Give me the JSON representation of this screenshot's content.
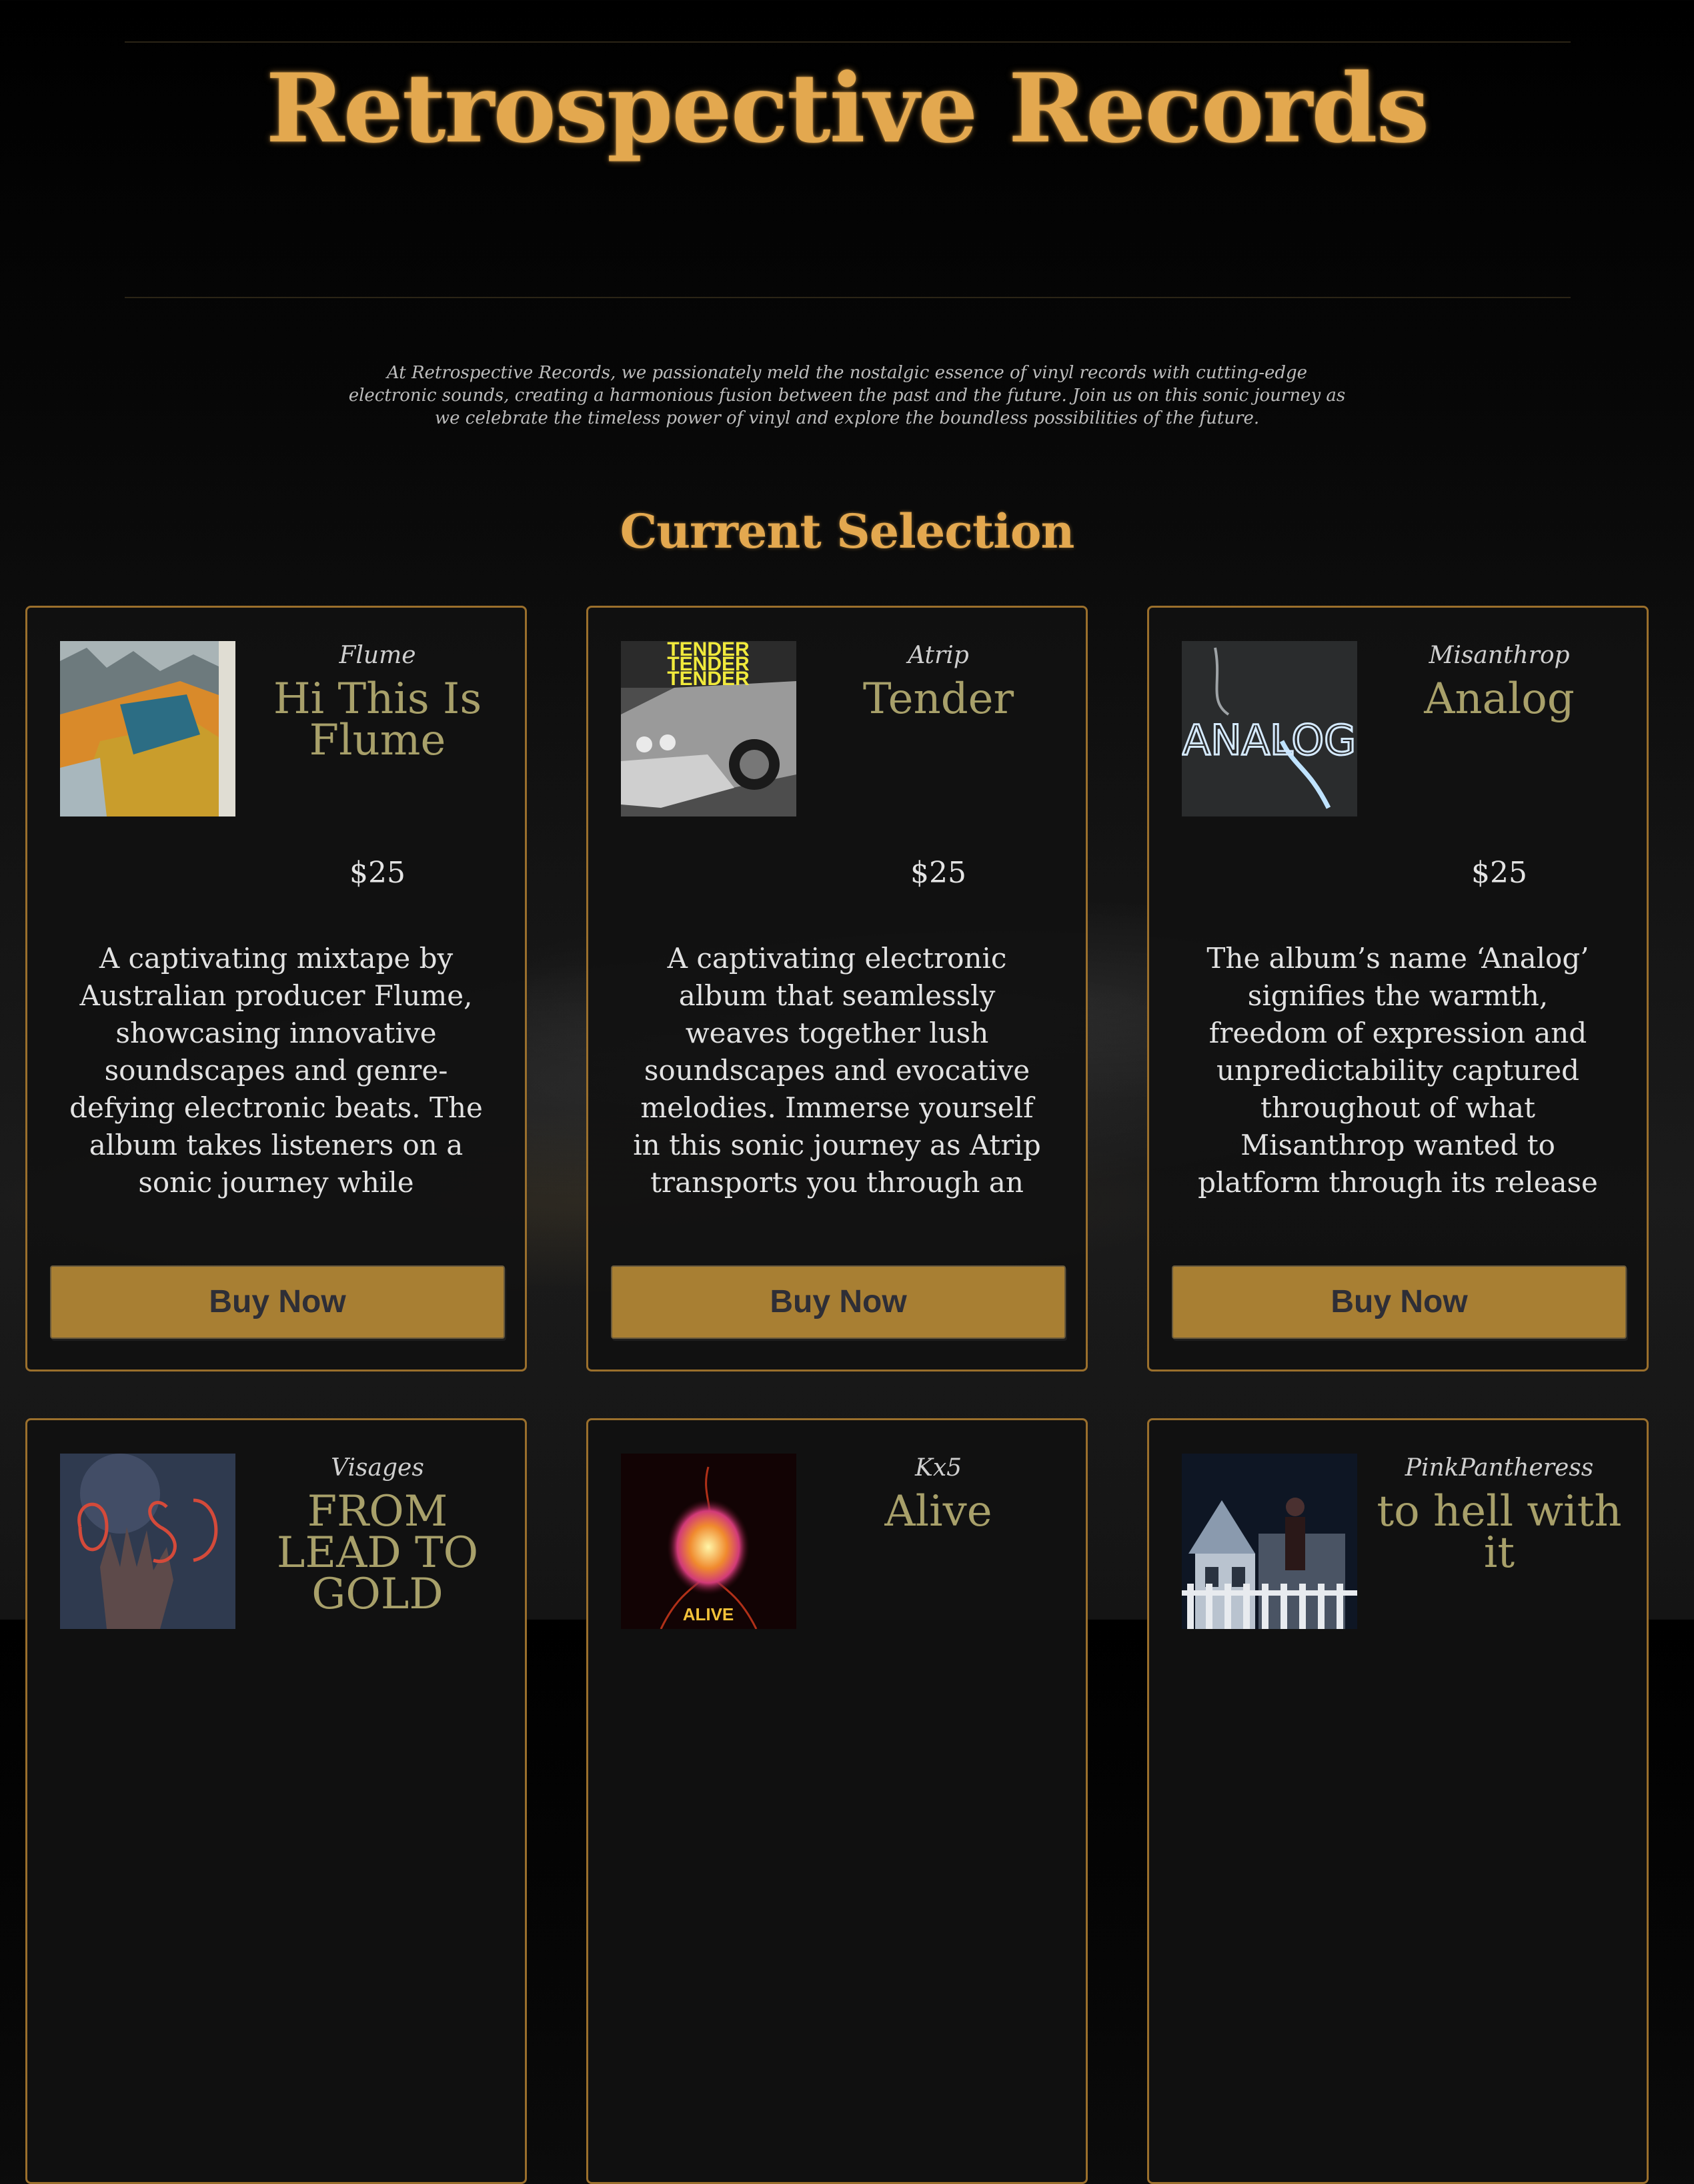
{
  "header": {
    "title": "Retrospective Records",
    "intro": "At Retrospective Records, we passionately meld the nostalgic essence of vinyl records with cutting-edge electronic sounds, creating a harmonious fusion between the past and the future. Join us on this sonic journey as we celebrate the timeless power of vinyl and explore the boundless possibilities of the future."
  },
  "selection": {
    "heading": "Current Selection",
    "records": [
      {
        "artist": "Flume",
        "album": "Hi This Is Flume",
        "price": "$25",
        "description": "A captivating mixtape by Australian producer Flume, showcasing innovative soundscapes and genre-defying electronic beats. The album takes listeners on a sonic journey while solidifying Flume's status as a",
        "buy_label": "Buy Now",
        "cover_icon": "car-hood-cover-art-icon"
      },
      {
        "artist": "Atrip",
        "album": "Tender",
        "price": "$25",
        "description": "A captivating electronic album that seamlessly weaves together lush soundscapes and evocative melodies. Immerse yourself in this sonic journey as Atrip transports you through an emotionally charged and exhilarating auditory",
        "buy_label": "Buy Now",
        "cover_icon": "silver-car-cover-art-icon",
        "cover_text": "TENDER"
      },
      {
        "artist": "Misanthrop",
        "album": "Analog",
        "price": "$25",
        "description": "The album’s name ‘Analog’ signifies the warmth, freedom of expression and unpredictability captured throughout of what Misanthrop wanted to platform through its release on his imprint Neosignal",
        "buy_label": "Buy Now",
        "cover_icon": "neon-cable-cover-art-icon",
        "cover_text": "ANALOG"
      },
      {
        "artist": "Visages",
        "album": "FROM LEAD TO GOLD",
        "price": "",
        "description": "",
        "buy_label": "",
        "cover_icon": "hand-cover-art-icon"
      },
      {
        "artist": "Kx5",
        "album": "Alive",
        "price": "",
        "description": "",
        "buy_label": "",
        "cover_icon": "glowing-orb-cover-art-icon",
        "cover_text": "ALIVE"
      },
      {
        "artist": "PinkPantheress",
        "album": "to hell with it",
        "price": "",
        "description": "",
        "buy_label": "",
        "cover_icon": "house-at-night-cover-art-icon"
      }
    ]
  }
}
